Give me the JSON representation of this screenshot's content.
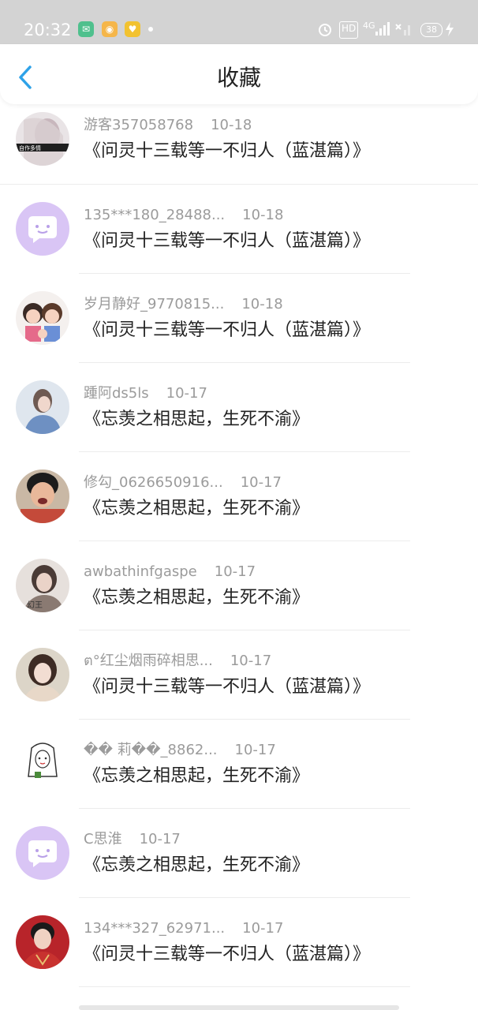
{
  "status_bar": {
    "time": "20:32",
    "apps": [
      "messages-app-icon",
      "weibo-app-icon",
      "yellow-app-icon"
    ],
    "hd_label": "HD",
    "network_label": "4G",
    "battery": "38"
  },
  "header": {
    "back_icon": "chevron-left-icon",
    "title": "收藏",
    "accent_color": "#2ea2e8"
  },
  "items": [
    {
      "user": "游客357058768",
      "date": "10-18",
      "work": "《问灵十三载等一不归人（蓝湛篇）》",
      "avatar": "photo"
    },
    {
      "user": "135***180_28488...",
      "date": "10-18",
      "work": "《问灵十三载等一不归人（蓝湛篇）》",
      "avatar": "default"
    },
    {
      "user": "岁月静好_9770815...",
      "date": "10-18",
      "work": "《问灵十三载等一不归人（蓝湛篇）》",
      "avatar": "cartoon"
    },
    {
      "user": "踵阿ds5ls",
      "date": "10-17",
      "work": "《忘羡之相思起，生死不渝》",
      "avatar": "photo"
    },
    {
      "user": "修勾_0626650916...",
      "date": "10-17",
      "work": "《忘羡之相思起，生死不渝》",
      "avatar": "photo"
    },
    {
      "user": "awbathinfgaspe",
      "date": "10-17",
      "work": "《忘羡之相思起，生死不渝》",
      "avatar": "photo"
    },
    {
      "user": "ต°红尘烟雨碎相思...",
      "date": "10-17",
      "work": "《问灵十三载等一不归人（蓝湛篇）》",
      "avatar": "photo"
    },
    {
      "user": "�� 莉��_8862...",
      "date": "10-17",
      "work": "《忘羡之相思起，生死不渝》",
      "avatar": "sketch"
    },
    {
      "user": "C思淮",
      "date": "10-17",
      "work": "《忘羡之相思起，生死不渝》",
      "avatar": "default"
    },
    {
      "user": "134***327_62971...",
      "date": "10-17",
      "work": "《问灵十三载等一不归人（蓝湛篇）》",
      "avatar": "photo"
    }
  ]
}
